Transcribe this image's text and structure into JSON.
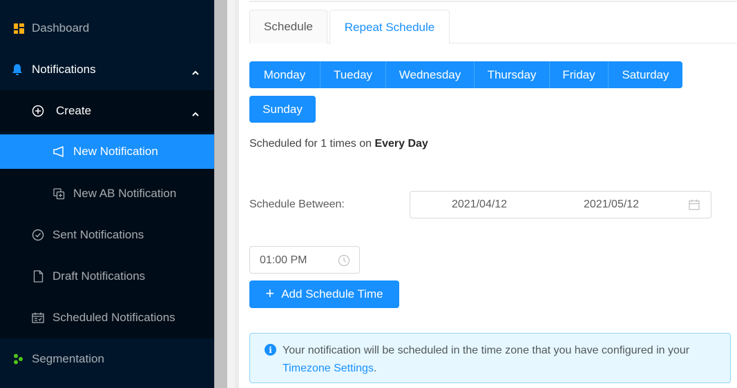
{
  "sidebar": {
    "items": [
      {
        "label": "Dashboard",
        "icon": "dashboard-icon",
        "icon_color": "#faad14"
      },
      {
        "label": "Notifications",
        "icon": "bell-icon",
        "icon_color": "#1890ff",
        "expanded": true
      },
      {
        "label": "Create",
        "icon": "plus-circle-icon",
        "expanded": true
      },
      {
        "label": "New Notification",
        "icon": "megaphone-icon",
        "active": true
      },
      {
        "label": "New AB Notification",
        "icon": "ab-copy-icon"
      },
      {
        "label": "Sent Notifications",
        "icon": "check-circle-icon"
      },
      {
        "label": "Draft Notifications",
        "icon": "file-icon"
      },
      {
        "label": "Scheduled Notifications",
        "icon": "schedule-icon"
      },
      {
        "label": "Segmentation",
        "icon": "segmentation-icon",
        "icon_color": "#52c41a"
      }
    ]
  },
  "tabs": [
    {
      "label": "Schedule",
      "active": false
    },
    {
      "label": "Repeat Schedule",
      "active": true
    }
  ],
  "days": [
    "Monday",
    "Tueday",
    "Wednesday",
    "Thursday",
    "Friday",
    "Saturday",
    "Sunday"
  ],
  "summary": {
    "prefix": "Scheduled for 1 times on ",
    "emphasis": "Every Day"
  },
  "schedule_between": {
    "label": "Schedule Between:",
    "start_date": "2021/04/12",
    "end_date": "2021/05/12"
  },
  "time_picker": {
    "value": "01:00 PM"
  },
  "add_button": {
    "label": "Add Schedule Time"
  },
  "alert": {
    "text": "Your notification will be scheduled in the time zone that you have configured in your ",
    "link": "Timezone Settings",
    "suffix": "."
  },
  "colors": {
    "primary": "#1890ff",
    "sidebar_bg": "#001529",
    "submenu_bg": "#000c17",
    "alert_bg": "#e6f7ff"
  }
}
